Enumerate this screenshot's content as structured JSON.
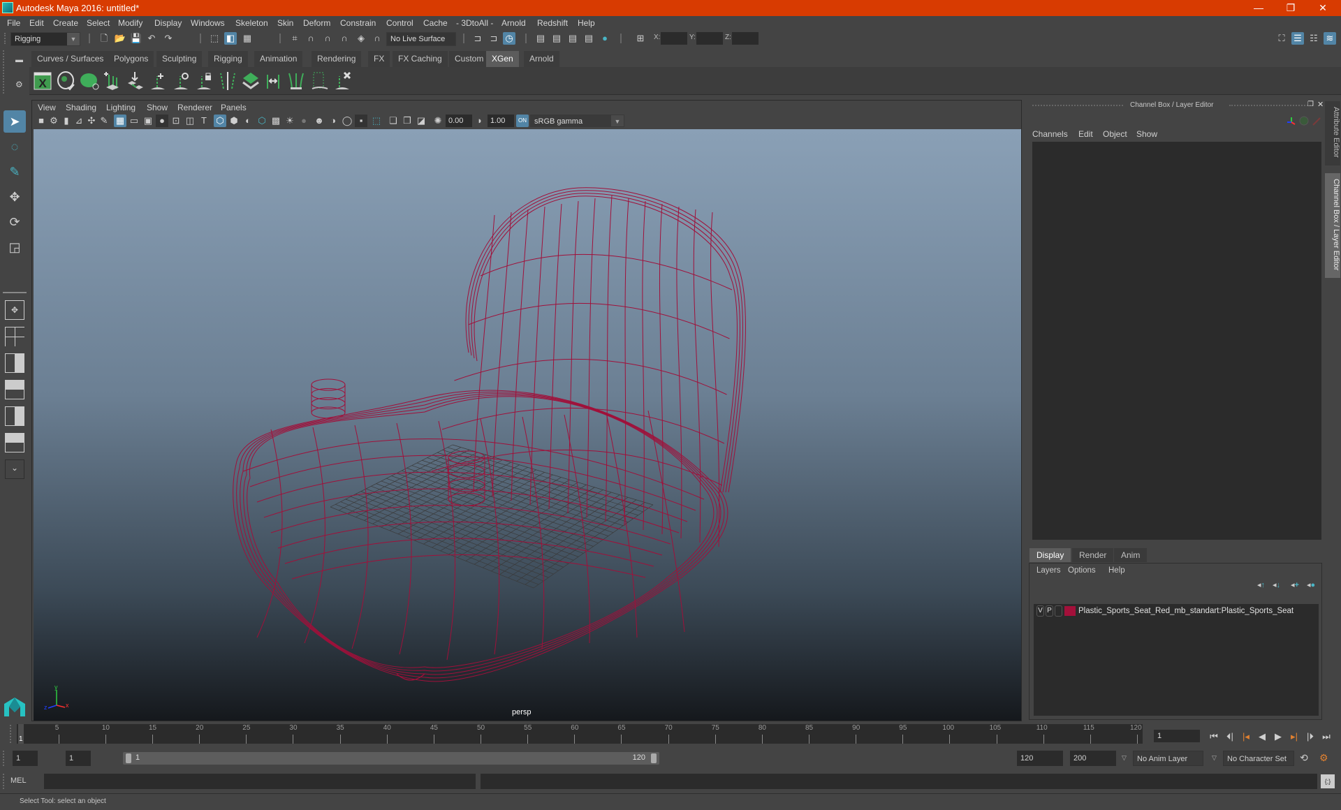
{
  "window": {
    "title": "Autodesk Maya 2016: untitled*",
    "controls": {
      "minimize": "—",
      "maximize": "❐",
      "close": "✕"
    },
    "title_bar_color": "#d83b01"
  },
  "menubar": [
    "File",
    "Edit",
    "Create",
    "Select",
    "Modify",
    "Display",
    "Windows",
    "Skeleton",
    "Skin",
    "Deform",
    "Constrain",
    "Control",
    "Cache",
    "- 3DtoAll -",
    "Arnold",
    "Redshift",
    "Help"
  ],
  "statusline": {
    "menuset": "Rigging",
    "live_surface": "No Live Surface",
    "xyz_labels": [
      "X:",
      "Y:",
      "Z:"
    ],
    "xyz_values": [
      "",
      "",
      ""
    ]
  },
  "shelf": {
    "tabs": [
      "Curves / Surfaces",
      "Polygons",
      "Sculpting",
      "Rigging",
      "Animation",
      "Rendering",
      "FX",
      "FX Caching",
      "Custom",
      "XGen",
      "Arnold"
    ],
    "active_tab": "XGen",
    "icons": [
      "xgen-editor-icon",
      "xgen-preview-icon",
      "xgen-clear-preview-icon",
      "add-guide-icon",
      "sculpt-guides-icon",
      "add-guide-tool-icon",
      "guide-lock-icon",
      "guide-lock-length-icon",
      "guides-mirror-icon",
      "density-icon",
      "rebuild-guides-icon",
      "scale-guides-icon",
      "select-guides-icon",
      "guide-cvs-icon",
      "delete-guides-icon"
    ]
  },
  "viewport": {
    "menu": [
      "View",
      "Shading",
      "Lighting",
      "Show",
      "Renderer",
      "Panels"
    ],
    "exposure": "0.00",
    "gamma": "1.00",
    "color_space": "sRGB gamma",
    "camera_label": "persp",
    "axis_labels": {
      "x": "x",
      "y": "y",
      "z": "z"
    },
    "wireframe_color": "#a0103a"
  },
  "right_panel": {
    "title": "Channel Box / Layer Editor",
    "channel_menu": [
      "Channels",
      "Edit",
      "Object",
      "Show"
    ],
    "layer_tabs": [
      "Display",
      "Render",
      "Anim"
    ],
    "active_layer_tab": "Display",
    "layer_menu": [
      "Layers",
      "Options",
      "Help"
    ],
    "layers": [
      {
        "visible": "V",
        "playback": "P",
        "color": "#a3103a",
        "name": "Plastic_Sports_Seat_Red_mb_standart:Plastic_Sports_Seat"
      }
    ],
    "side_tabs": [
      "Attribute Editor",
      "Channel Box / Layer Editor"
    ]
  },
  "timeline": {
    "ticks": [
      5,
      10,
      15,
      20,
      25,
      30,
      35,
      40,
      45,
      50,
      55,
      60,
      65,
      70,
      75,
      80,
      85,
      90,
      95,
      100,
      105,
      110,
      115,
      120
    ],
    "current_frame_marker": "1",
    "current_frame": "1",
    "min": 1,
    "max": 120
  },
  "range": {
    "start": "1",
    "playback_start": "1",
    "slider_start": "1",
    "slider_end": "120",
    "playback_end": "120",
    "end": "200",
    "anim_layer": "No Anim Layer",
    "character_set": "No Character Set"
  },
  "command_line": {
    "label": "MEL",
    "input": "",
    "output": ""
  },
  "help_line": "Select Tool: select an object"
}
